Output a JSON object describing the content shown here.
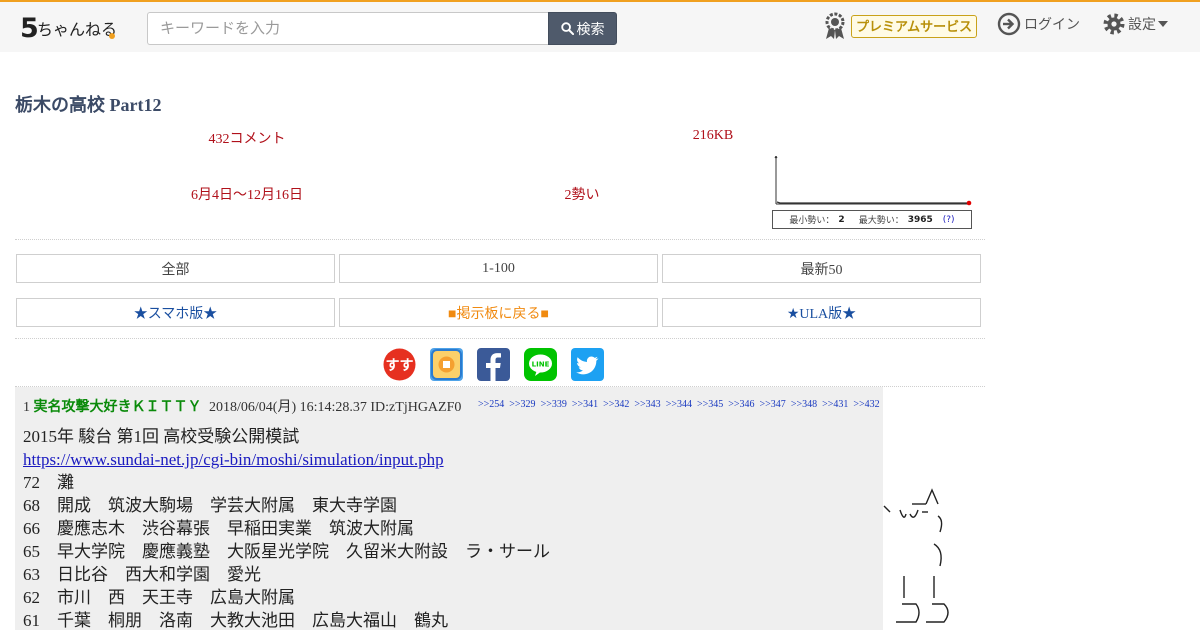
{
  "header": {
    "search_placeholder": "キーワードを入力",
    "search_button": "検索",
    "premium_label": "プレミアムサービス",
    "login_label": "ログイン",
    "settings_label": "設定"
  },
  "thread": {
    "title": "栃木の高校 Part12",
    "comments": "432コメント",
    "size": "216KB",
    "date_range": "6月4日〜12月16日",
    "momentum": "2勢い",
    "graph_min_label": "最小勢い：",
    "graph_min": "2",
    "graph_max_label": "最大勢い：",
    "graph_max": "3965",
    "graph_help": "(?)"
  },
  "nav": {
    "all": "全部",
    "range": "1-100",
    "latest": "最新50",
    "smartphone": "★スマホ版★",
    "back": "■掲示板に戻る■",
    "ula": "★ULA版★"
  },
  "post": {
    "number": "1",
    "name": "実名攻撃大好きＫＩＴＴＹ",
    "datetime": "2018/06/04(月) 16:14:28.37",
    "id": "ID:zTjHGAZF0",
    "replies": [
      ">>254",
      ">>329",
      ">>339",
      ">>341",
      ">>342",
      ">>343",
      ">>344",
      ">>345",
      ">>346",
      ">>347",
      ">>348",
      ">>431",
      ">>432"
    ],
    "line1": "2015年 駿台 第1回 高校受験公開模試",
    "link": "https://www.sundai-net.jp/cgi-bin/moshi/simulation/input.php",
    "lines": [
      "72　灘",
      "68　開成　筑波大駒場　学芸大附属　東大寺学園",
      "66　慶應志木　渋谷幕張　早稲田実業　筑波大附属",
      "65　早大学院　慶應義塾　大阪星光学院　久留米大附設　ラ・サール",
      "63　日比谷　西大和学園　愛光",
      "62　市川　西　天王寺　広島大附属",
      "61　千葉　桐朋　洛南　大教大池田　広島大福山　鶴丸"
    ]
  },
  "colors": {
    "accent": "#f0a020",
    "title": "#3b4a66",
    "meta": "#b0101a",
    "name": "#0a8a0a",
    "link": "#1a1ac0"
  }
}
